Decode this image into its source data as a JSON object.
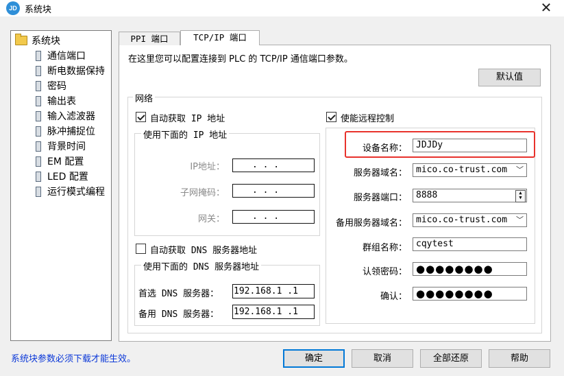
{
  "window": {
    "title": "系统块",
    "app_icon_text": "JD"
  },
  "tree": {
    "root": "系统块",
    "items": [
      "通信端口",
      "断电数据保持",
      "密码",
      "输出表",
      "输入滤波器",
      "脉冲捕捉位",
      "背景时间",
      "EM 配置",
      "LED 配置",
      "运行模式编程"
    ]
  },
  "tabs": [
    {
      "label": "PPI 端口",
      "active": false
    },
    {
      "label": "TCP/IP 端口",
      "active": true
    }
  ],
  "panel": {
    "description": "在这里您可以配置连接到 PLC 的 TCP/IP 通信端口参数。",
    "default_button": "默认值",
    "network_group": "网络",
    "auto_ip": {
      "label": "自动获取 IP 地址",
      "checked": true
    },
    "manual_ip_group": "使用下面的 IP 地址",
    "ip_fields": [
      {
        "label": "IP地址：",
        "value": ".    .    ."
      },
      {
        "label": "子网掩码：",
        "value": ".    .    ."
      },
      {
        "label": "网关：",
        "value": ".    .    ."
      }
    ],
    "auto_dns": {
      "label": "自动获取 DNS 服务器地址",
      "checked": false
    },
    "manual_dns_group": "使用下面的 DNS 服务器地址",
    "dns_fields": [
      {
        "label": "首选 DNS 服务器：",
        "value": "192.168.1   .1"
      },
      {
        "label": "备用 DNS 服务器：",
        "value": "192.168.1   .1"
      }
    ],
    "remote": {
      "label": "使能远程控制",
      "checked": true,
      "device_name": {
        "label": "设备名称：",
        "value": "JDJDy"
      },
      "server_domain": {
        "label": "服务器域名：",
        "value": "mico.co-trust.com"
      },
      "server_port": {
        "label": "服务器端口：",
        "value": "8888"
      },
      "backup_domain": {
        "label": "备用服务器域名：",
        "value": "mico.co-trust.com"
      },
      "group_name": {
        "label": "群组名称：",
        "value": "cqytest"
      },
      "claim_password": {
        "label": "认领密码：",
        "value": "●●●●●●●●"
      },
      "confirm": {
        "label": "确认：",
        "value": "●●●●●●●●"
      }
    }
  },
  "footer": {
    "note": "系统块参数必须下载才能生效。",
    "ok": "确定",
    "cancel": "取消",
    "restore_all": "全部还原",
    "help": "帮助"
  },
  "colors": {
    "highlight": "#e8312b",
    "footer_note": "#0b38d8",
    "panel_bg": "#ffffff",
    "window_bg": "#f0f0f0"
  }
}
